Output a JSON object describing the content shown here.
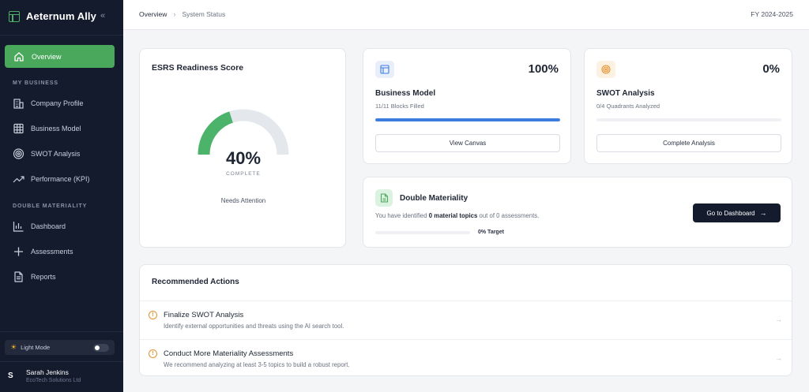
{
  "sidebar": {
    "brand": "Aeternum Ally",
    "collapse_glyph": "«",
    "active_item": {
      "label": "Overview",
      "icon": "home-icon"
    },
    "sections": [
      {
        "label": "MY BUSINESS",
        "items": [
          {
            "label": "Company Profile",
            "icon": "building-icon"
          },
          {
            "label": "Business Model",
            "icon": "grid-icon"
          },
          {
            "label": "SWOT Analysis",
            "icon": "target-icon"
          },
          {
            "label": "Performance (KPI)",
            "icon": "trending-up-icon"
          }
        ]
      },
      {
        "label": "DOUBLE MATERIALITY",
        "items": [
          {
            "label": "Dashboard",
            "icon": "bar-chart-icon"
          },
          {
            "label": "Assessments",
            "icon": "plus-icon"
          },
          {
            "label": "Reports",
            "icon": "document-icon"
          }
        ]
      }
    ],
    "theme_toggle": {
      "label": "Light Mode",
      "on": false
    },
    "user": {
      "initial": "S",
      "name": "Sarah Jenkins",
      "org": "EcoTech Solutions Ltd"
    }
  },
  "topbar": {
    "breadcrumb": [
      "Overview",
      "System Status"
    ],
    "breadcrumb_sep": "›",
    "fiscal_year": "FY 2024-2025"
  },
  "readiness": {
    "title": "ESRS Readiness Score",
    "value_pct": 40,
    "value_text": "40%",
    "sub": "COMPLETE",
    "status": "Needs Attention",
    "colors": {
      "fill": "#4cb36a",
      "track": "#e4e7ec"
    }
  },
  "business_model": {
    "value": "100%",
    "title": "Business Model",
    "sub": "11/11 Blocks Filled",
    "progress": 1.0,
    "button": "View Canvas",
    "icon_color": "#3e7de0"
  },
  "swot": {
    "value": "0%",
    "title": "SWOT Analysis",
    "sub": "0/4 Quadrants Analyzed",
    "progress": 0.0,
    "button": "Complete Analysis",
    "icon_color": "#e5902c"
  },
  "double_materiality": {
    "title": "Double Materiality",
    "desc_pre": "You have identified ",
    "desc_bold": "0 material topics",
    "desc_post": " out of 0 assessments.",
    "progress": 0.0,
    "target": "0% Target",
    "button": "Go to Dashboard",
    "button_arrow": "→"
  },
  "recommended": {
    "title": "Recommended Actions",
    "warn_glyph": "!",
    "chevron": "→",
    "items": [
      {
        "title": "Finalize SWOT Analysis",
        "desc": "Identify external opportunities and threats using the AI search tool."
      },
      {
        "title": "Conduct More Materiality Assessments",
        "desc": "We recommend analyzing at least 3-5 topics to build a robust report."
      }
    ]
  }
}
